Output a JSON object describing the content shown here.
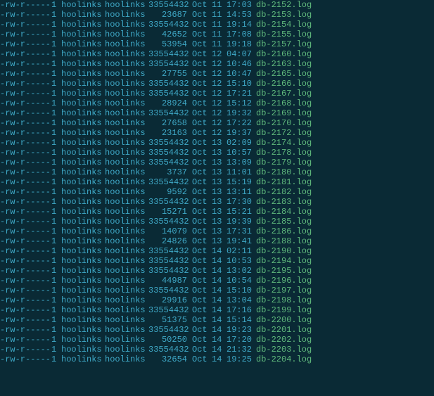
{
  "files": [
    {
      "perms": "-rw-r-----",
      "links": "1",
      "owner": "hoolinks",
      "group": "hoolinks",
      "size": "33554432",
      "month": "Oct",
      "day": "11",
      "time": "17:03",
      "filename": "db-2152.log"
    },
    {
      "perms": "-rw-r-----",
      "links": "1",
      "owner": "hoolinks",
      "group": "hoolinks",
      "size": "23687",
      "month": "Oct",
      "day": "11",
      "time": "14:53",
      "filename": "db-2153.log"
    },
    {
      "perms": "-rw-r-----",
      "links": "1",
      "owner": "hoolinks",
      "group": "hoolinks",
      "size": "33554432",
      "month": "Oct",
      "day": "11",
      "time": "19:14",
      "filename": "db-2154.log"
    },
    {
      "perms": "-rw-r-----",
      "links": "1",
      "owner": "hoolinks",
      "group": "hoolinks",
      "size": "42652",
      "month": "Oct",
      "day": "11",
      "time": "17:08",
      "filename": "db-2155.log"
    },
    {
      "perms": "-rw-r-----",
      "links": "1",
      "owner": "hoolinks",
      "group": "hoolinks",
      "size": "53954",
      "month": "Oct",
      "day": "11",
      "time": "19:18",
      "filename": "db-2157.log"
    },
    {
      "perms": "-rw-r-----",
      "links": "1",
      "owner": "hoolinks",
      "group": "hoolinks",
      "size": "33554432",
      "month": "Oct",
      "day": "12",
      "time": "04:07",
      "filename": "db-2160.log"
    },
    {
      "perms": "-rw-r-----",
      "links": "1",
      "owner": "hoolinks",
      "group": "hoolinks",
      "size": "33554432",
      "month": "Oct",
      "day": "12",
      "time": "10:46",
      "filename": "db-2163.log"
    },
    {
      "perms": "-rw-r-----",
      "links": "1",
      "owner": "hoolinks",
      "group": "hoolinks",
      "size": "27755",
      "month": "Oct",
      "day": "12",
      "time": "10:47",
      "filename": "db-2165.log"
    },
    {
      "perms": "-rw-r-----",
      "links": "1",
      "owner": "hoolinks",
      "group": "hoolinks",
      "size": "33554432",
      "month": "Oct",
      "day": "12",
      "time": "15:10",
      "filename": "db-2166.log"
    },
    {
      "perms": "-rw-r-----",
      "links": "1",
      "owner": "hoolinks",
      "group": "hoolinks",
      "size": "33554432",
      "month": "Oct",
      "day": "12",
      "time": "17:21",
      "filename": "db-2167.log"
    },
    {
      "perms": "-rw-r-----",
      "links": "1",
      "owner": "hoolinks",
      "group": "hoolinks",
      "size": "28924",
      "month": "Oct",
      "day": "12",
      "time": "15:12",
      "filename": "db-2168.log"
    },
    {
      "perms": "-rw-r-----",
      "links": "1",
      "owner": "hoolinks",
      "group": "hoolinks",
      "size": "33554432",
      "month": "Oct",
      "day": "12",
      "time": "19:32",
      "filename": "db-2169.log"
    },
    {
      "perms": "-rw-r-----",
      "links": "1",
      "owner": "hoolinks",
      "group": "hoolinks",
      "size": "27658",
      "month": "Oct",
      "day": "12",
      "time": "17:22",
      "filename": "db-2170.log"
    },
    {
      "perms": "-rw-r-----",
      "links": "1",
      "owner": "hoolinks",
      "group": "hoolinks",
      "size": "23163",
      "month": "Oct",
      "day": "12",
      "time": "19:37",
      "filename": "db-2172.log"
    },
    {
      "perms": "-rw-r-----",
      "links": "1",
      "owner": "hoolinks",
      "group": "hoolinks",
      "size": "33554432",
      "month": "Oct",
      "day": "13",
      "time": "02:09",
      "filename": "db-2174.log"
    },
    {
      "perms": "-rw-r-----",
      "links": "1",
      "owner": "hoolinks",
      "group": "hoolinks",
      "size": "33554432",
      "month": "Oct",
      "day": "13",
      "time": "10:57",
      "filename": "db-2178.log"
    },
    {
      "perms": "-rw-r-----",
      "links": "1",
      "owner": "hoolinks",
      "group": "hoolinks",
      "size": "33554432",
      "month": "Oct",
      "day": "13",
      "time": "13:09",
      "filename": "db-2179.log"
    },
    {
      "perms": "-rw-r-----",
      "links": "1",
      "owner": "hoolinks",
      "group": "hoolinks",
      "size": "3737",
      "month": "Oct",
      "day": "13",
      "time": "11:01",
      "filename": "db-2180.log"
    },
    {
      "perms": "-rw-r-----",
      "links": "1",
      "owner": "hoolinks",
      "group": "hoolinks",
      "size": "33554432",
      "month": "Oct",
      "day": "13",
      "time": "15:19",
      "filename": "db-2181.log"
    },
    {
      "perms": "-rw-r-----",
      "links": "1",
      "owner": "hoolinks",
      "group": "hoolinks",
      "size": "9592",
      "month": "Oct",
      "day": "13",
      "time": "13:11",
      "filename": "db-2182.log"
    },
    {
      "perms": "-rw-r-----",
      "links": "1",
      "owner": "hoolinks",
      "group": "hoolinks",
      "size": "33554432",
      "month": "Oct",
      "day": "13",
      "time": "17:30",
      "filename": "db-2183.log"
    },
    {
      "perms": "-rw-r-----",
      "links": "1",
      "owner": "hoolinks",
      "group": "hoolinks",
      "size": "15271",
      "month": "Oct",
      "day": "13",
      "time": "15:21",
      "filename": "db-2184.log"
    },
    {
      "perms": "-rw-r-----",
      "links": "1",
      "owner": "hoolinks",
      "group": "hoolinks",
      "size": "33554432",
      "month": "Oct",
      "day": "13",
      "time": "19:39",
      "filename": "db-2185.log"
    },
    {
      "perms": "-rw-r-----",
      "links": "1",
      "owner": "hoolinks",
      "group": "hoolinks",
      "size": "14079",
      "month": "Oct",
      "day": "13",
      "time": "17:31",
      "filename": "db-2186.log"
    },
    {
      "perms": "-rw-r-----",
      "links": "1",
      "owner": "hoolinks",
      "group": "hoolinks",
      "size": "24826",
      "month": "Oct",
      "day": "13",
      "time": "19:41",
      "filename": "db-2188.log"
    },
    {
      "perms": "-rw-r-----",
      "links": "1",
      "owner": "hoolinks",
      "group": "hoolinks",
      "size": "33554432",
      "month": "Oct",
      "day": "14",
      "time": "02:11",
      "filename": "db-2190.log"
    },
    {
      "perms": "-rw-r-----",
      "links": "1",
      "owner": "hoolinks",
      "group": "hoolinks",
      "size": "33554432",
      "month": "Oct",
      "day": "14",
      "time": "10:53",
      "filename": "db-2194.log"
    },
    {
      "perms": "-rw-r-----",
      "links": "1",
      "owner": "hoolinks",
      "group": "hoolinks",
      "size": "33554432",
      "month": "Oct",
      "day": "14",
      "time": "13:02",
      "filename": "db-2195.log"
    },
    {
      "perms": "-rw-r-----",
      "links": "1",
      "owner": "hoolinks",
      "group": "hoolinks",
      "size": "44987",
      "month": "Oct",
      "day": "14",
      "time": "10:54",
      "filename": "db-2196.log"
    },
    {
      "perms": "-rw-r-----",
      "links": "1",
      "owner": "hoolinks",
      "group": "hoolinks",
      "size": "33554432",
      "month": "Oct",
      "day": "14",
      "time": "15:10",
      "filename": "db-2197.log"
    },
    {
      "perms": "-rw-r-----",
      "links": "1",
      "owner": "hoolinks",
      "group": "hoolinks",
      "size": "29916",
      "month": "Oct",
      "day": "14",
      "time": "13:04",
      "filename": "db-2198.log"
    },
    {
      "perms": "-rw-r-----",
      "links": "1",
      "owner": "hoolinks",
      "group": "hoolinks",
      "size": "33554432",
      "month": "Oct",
      "day": "14",
      "time": "17:16",
      "filename": "db-2199.log"
    },
    {
      "perms": "-rw-r-----",
      "links": "1",
      "owner": "hoolinks",
      "group": "hoolinks",
      "size": "51375",
      "month": "Oct",
      "day": "14",
      "time": "15:14",
      "filename": "db-2200.log"
    },
    {
      "perms": "-rw-r-----",
      "links": "1",
      "owner": "hoolinks",
      "group": "hoolinks",
      "size": "33554432",
      "month": "Oct",
      "day": "14",
      "time": "19:23",
      "filename": "db-2201.log"
    },
    {
      "perms": "-rw-r-----",
      "links": "1",
      "owner": "hoolinks",
      "group": "hoolinks",
      "size": "50250",
      "month": "Oct",
      "day": "14",
      "time": "17:20",
      "filename": "db-2202.log"
    },
    {
      "perms": "-rw-r-----",
      "links": "1",
      "owner": "hoolinks",
      "group": "hoolinks",
      "size": "33554432",
      "month": "Oct",
      "day": "14",
      "time": "21:32",
      "filename": "db-2203.log"
    },
    {
      "perms": "-rw-r-----",
      "links": "1",
      "owner": "hoolinks",
      "group": "hoolinks",
      "size": "32654",
      "month": "Oct",
      "day": "14",
      "time": "19:25",
      "filename": "db-2204.log"
    }
  ]
}
